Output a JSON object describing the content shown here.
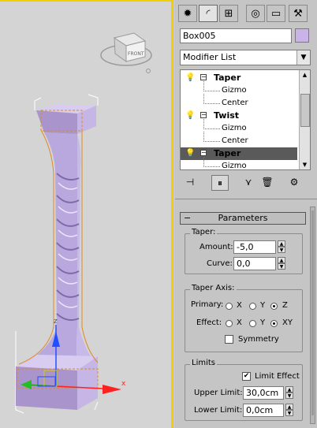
{
  "viewport": {
    "gizmo_label": "FRONT"
  },
  "panel": {
    "object_name": "Box005",
    "object_color": "#c9b3e8",
    "modifier_list": "Modifier List",
    "stack": [
      {
        "name": "Taper",
        "type": "modifier"
      },
      {
        "name": "Gizmo",
        "type": "sub"
      },
      {
        "name": "Center",
        "type": "sub"
      },
      {
        "name": "Twist",
        "type": "modifier"
      },
      {
        "name": "Gizmo",
        "type": "sub"
      },
      {
        "name": "Center",
        "type": "sub"
      },
      {
        "name": "Taper",
        "type": "modifier",
        "selected": true
      },
      {
        "name": "Gizmo",
        "type": "sub"
      }
    ]
  },
  "params": {
    "title": "Parameters",
    "taper": {
      "title": "Taper:",
      "amount_label": "Amount:",
      "amount": "-5,0",
      "curve_label": "Curve:",
      "curve": "0,0"
    },
    "axis": {
      "title": "Taper Axis:",
      "primary_label": "Primary:",
      "effect_label": "Effect:",
      "primary_options": [
        "X",
        "Y",
        "Z"
      ],
      "primary_selected": "Z",
      "effect_options": [
        "X",
        "Y",
        "XY"
      ],
      "effect_selected": "XY",
      "symmetry_label": "Symmetry",
      "symmetry_checked": false
    },
    "limits": {
      "title": "Limits",
      "effect_label": "Limit Effect",
      "effect_checked": true,
      "upper_label": "Upper Limit:",
      "upper": "30,0cm",
      "lower_label": "Lower Limit:",
      "lower": "0,0cm"
    }
  }
}
